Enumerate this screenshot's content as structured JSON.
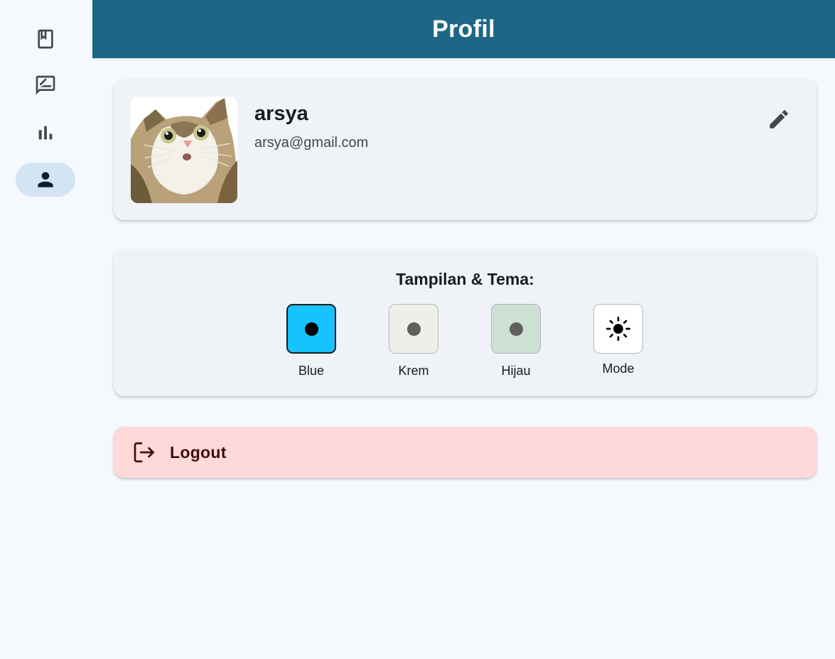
{
  "header": {
    "title": "Profil"
  },
  "rail": {
    "items": [
      {
        "icon": "bookmark-book-icon",
        "active": false
      },
      {
        "icon": "rate-review-icon",
        "active": false
      },
      {
        "icon": "bar-chart-icon",
        "active": false
      },
      {
        "icon": "person-icon",
        "active": true
      }
    ],
    "active_color": "#d3e4f2"
  },
  "profile": {
    "avatar_icon": "surprised-cat-photo",
    "username": "arsya",
    "email": "arsya@gmail.com",
    "edit_icon": "pencil-icon"
  },
  "theme": {
    "title": "Tampilan & Tema:",
    "options": [
      {
        "label": "Blue",
        "color": "#17c3ff",
        "selected": true
      },
      {
        "label": "Krem",
        "color": "#efefea",
        "selected": false
      },
      {
        "label": "Hijau",
        "color": "#cde0d4",
        "selected": false
      }
    ],
    "mode": {
      "label": "Mode",
      "icon": "sun-icon",
      "color": "#ffffff"
    }
  },
  "logout": {
    "label": "Logout",
    "icon": "logout-icon",
    "background": "#ffd9d9",
    "text_color": "#410e0b"
  },
  "colors": {
    "header": "#1d6686",
    "page_background": "#f5f8fc",
    "card_background": "#eff2f7"
  }
}
